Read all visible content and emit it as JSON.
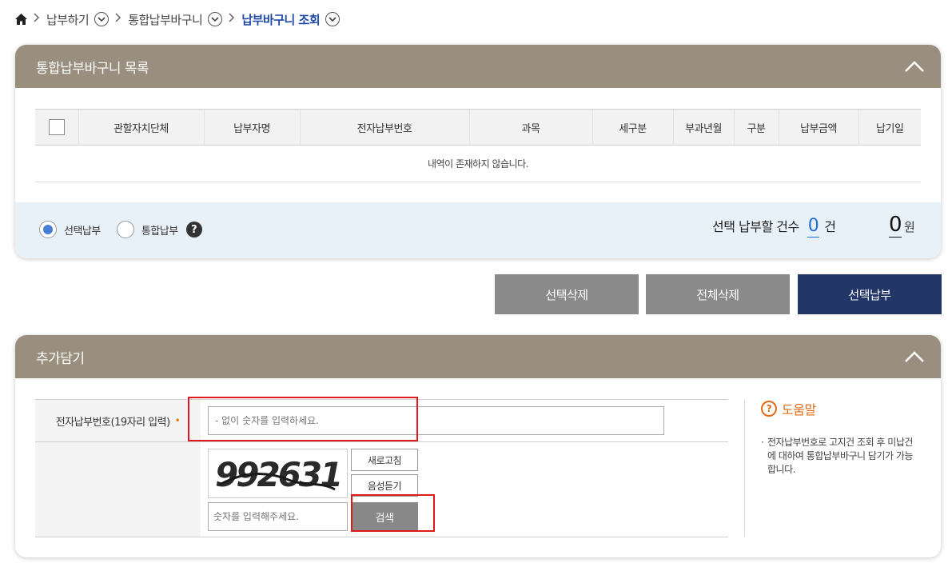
{
  "breadcrumb": {
    "items": [
      {
        "label": "납부하기"
      },
      {
        "label": "통합납부바구니"
      },
      {
        "label": "납부바구니 조회"
      }
    ]
  },
  "list_panel": {
    "title": "통합납부바구니 목록",
    "columns": [
      "관할자치단체",
      "납부자명",
      "전자납부번호",
      "과목",
      "세구분",
      "부과년월",
      "구분",
      "납부금액",
      "납기일"
    ],
    "empty_message": "내역이 존재하지 않습니다.",
    "radio": {
      "option1": "선택납부",
      "option2": "통합납부"
    },
    "help_glyph": "?",
    "count_label": "선택 납부할 건수",
    "count_value": "0",
    "count_unit": "건",
    "amount_value": "0",
    "amount_unit": "원"
  },
  "actions": {
    "delete_selected": "선택삭제",
    "delete_all": "전체삭제",
    "pay_selected": "선택납부"
  },
  "add_panel": {
    "title": "추가담기",
    "field_label": "전자납부번호(19자리 입력)",
    "required_mark": "•",
    "field_placeholder": "- 없이 숫자를 입력하세요.",
    "captcha_text": "992631",
    "refresh_label": "새로고침",
    "audio_label": "음성듣기",
    "captcha_placeholder": "숫자를 입력해주세요.",
    "search_label": "검색",
    "help_title": "도움말",
    "help_text": "전자납부번호로 고지건 조회 후 미납건에 대하여 통합납부바구니 담기가 가능합니다."
  },
  "colors": {
    "panel_header": "#9a8f7f",
    "summary_bg": "#e9f1f8",
    "primary_button": "#233668",
    "secondary_button": "#8a8a8a",
    "highlight_box": "#e01a1a",
    "help_accent": "#e06a16"
  },
  "icons": [
    "home-icon",
    "chevron-right-icon",
    "chevron-down-circle-icon",
    "chevron-up-icon",
    "question-icon"
  ]
}
